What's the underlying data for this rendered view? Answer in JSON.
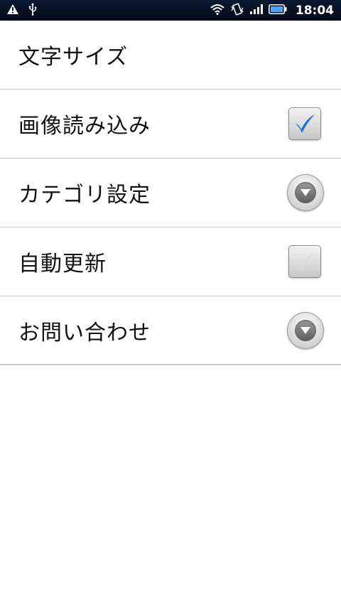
{
  "status_bar": {
    "time": "18:04",
    "left_icons": [
      "warning-icon",
      "usb-icon"
    ],
    "right_icons": [
      "wifi-icon",
      "vibrate-icon",
      "signal-icon",
      "battery-icon"
    ]
  },
  "settings": {
    "items": [
      {
        "label": "文字サイズ",
        "widget": "none"
      },
      {
        "label": "画像読み込み",
        "widget": "checkbox",
        "checked": true
      },
      {
        "label": "カテゴリ設定",
        "widget": "dropdown"
      },
      {
        "label": "自動更新",
        "widget": "checkbox",
        "checked": false
      },
      {
        "label": "お問い合わせ",
        "widget": "dropdown"
      }
    ]
  },
  "colors": {
    "status_bar_bg": "#0a1930",
    "check_checked": "#1a6fe0",
    "check_unchecked": "#d8d8d8",
    "divider": "#c4c4c4"
  }
}
